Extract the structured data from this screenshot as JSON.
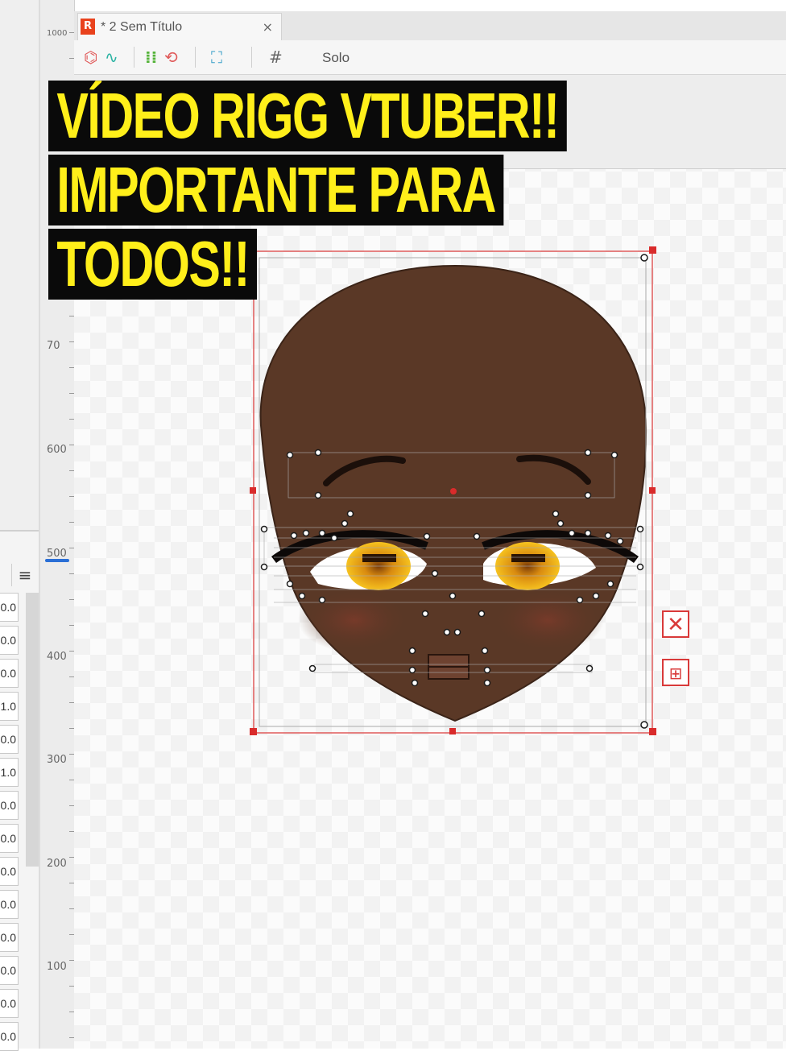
{
  "document_tab": {
    "icon": "R",
    "title": "* 2 Sem Título",
    "close": "×"
  },
  "toolbar": {
    "tools": [
      {
        "icon": "deform-path-icon",
        "glyph": "⌬"
      },
      {
        "icon": "glue-icon",
        "glyph": "⟲"
      },
      {
        "icon": "fit-view-icon",
        "glyph": "⛶"
      },
      {
        "icon": "grid-icon",
        "glyph": "#"
      }
    ],
    "solo_label": "Solo"
  },
  "ruler": {
    "labels": [
      "1000",
      "70",
      "600",
      "500",
      "400",
      "300",
      "200",
      "100"
    ]
  },
  "params": {
    "values": [
      "0.0",
      "0.0",
      "0.0",
      "1.0",
      "0.0",
      "1.0",
      "0.0",
      "0.0",
      "0.0",
      "0.0",
      "0.0",
      "0.0",
      "0.0",
      "0.0"
    ]
  },
  "caption": {
    "lines": [
      "VÍDEO RIGG VTUBER!!",
      "IMPORTANTE PARA",
      "TODOS!!"
    ]
  },
  "colors": {
    "skin": "#5a3826",
    "iris": "#e8a417",
    "caption_text": "#ffef1a",
    "handle": "#d92b2b"
  }
}
